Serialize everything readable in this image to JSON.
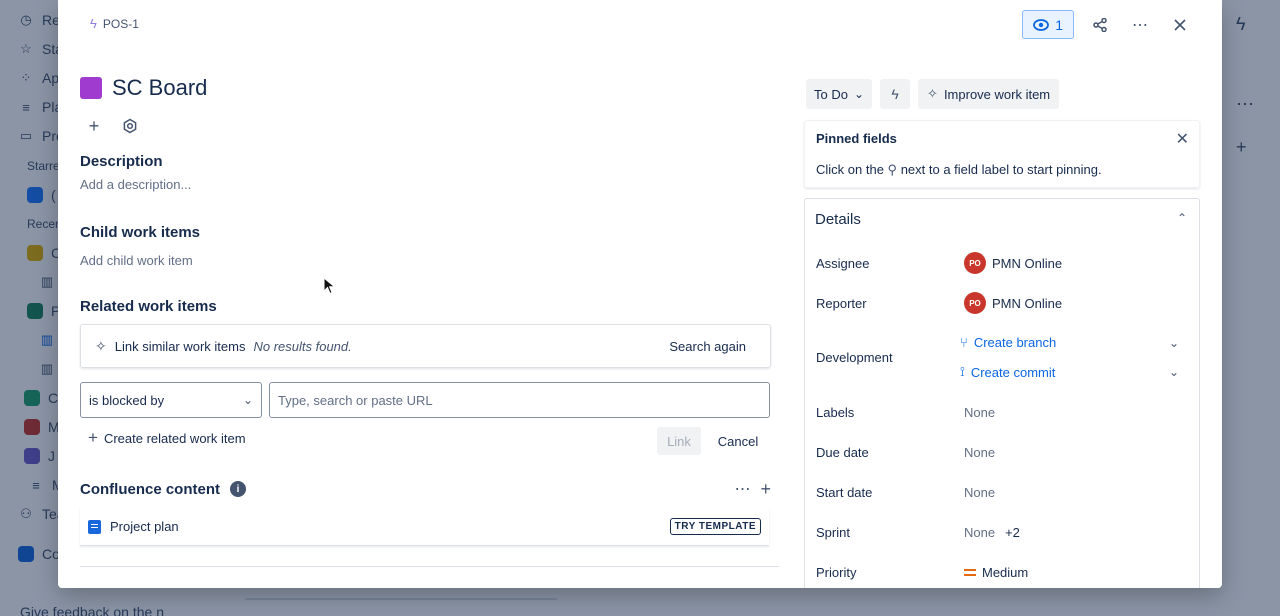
{
  "background": {
    "sidebar": [
      {
        "label": "Rec",
        "icon": "clock-icon"
      },
      {
        "label": "Sta",
        "icon": "star-icon"
      },
      {
        "label": "App",
        "icon": "apps-icon"
      },
      {
        "label": "Pla",
        "icon": "plans-icon"
      },
      {
        "label": "Pro",
        "icon": "projects-icon"
      },
      {
        "label": "Starre",
        "icon": ""
      },
      {
        "label": "(",
        "icon": "cloud-project-icon"
      },
      {
        "label": "Recen",
        "icon": ""
      },
      {
        "label": "C",
        "icon": "pencil-project-icon"
      },
      {
        "label": "",
        "icon": "board-icon"
      },
      {
        "label": "P",
        "icon": "rocket-project-icon"
      },
      {
        "label": "",
        "icon": "board-icon"
      },
      {
        "label": "",
        "icon": "board-icon"
      },
      {
        "label": "C",
        "icon": "green-project-icon"
      },
      {
        "label": "M",
        "icon": "red-project-icon"
      },
      {
        "label": "J",
        "icon": "bus-project-icon"
      },
      {
        "label": "M",
        "icon": "more-icon"
      },
      {
        "label": "Tea",
        "icon": "teams-icon"
      },
      {
        "label": "Co",
        "icon": "confluence-icon"
      }
    ],
    "feedback": "Give feedback on the n"
  },
  "modal": {
    "issue_key": "POS-1",
    "watch_count": "1",
    "title": "SC Board",
    "description": {
      "heading": "Description",
      "placeholder": "Add a description..."
    },
    "child": {
      "heading": "Child work items",
      "add": "Add child work item"
    },
    "related": {
      "heading": "Related work items",
      "similar_label": "Link similar work items",
      "no_results": "No results found.",
      "search_again": "Search again",
      "relation_type": "is blocked by",
      "url_placeholder": "Type, search or paste URL",
      "create": "Create related work item",
      "link": "Link",
      "cancel": "Cancel"
    },
    "confluence": {
      "heading": "Confluence content",
      "page_title": "Project plan",
      "badge": "TRY TEMPLATE"
    }
  },
  "side": {
    "status": "To Do",
    "improve": "Improve work item",
    "pinned": {
      "title": "Pinned fields",
      "hint_before": "Click on the",
      "hint_after": "next to a field label to start pinning."
    },
    "details": {
      "title": "Details",
      "assignee_label": "Assignee",
      "assignee_initials": "PO",
      "assignee_name": "PMN Online",
      "reporter_label": "Reporter",
      "reporter_initials": "PO",
      "reporter_name": "PMN Online",
      "development_label": "Development",
      "create_branch": "Create branch",
      "create_commit": "Create commit",
      "labels_label": "Labels",
      "labels_value": "None",
      "due_label": "Due date",
      "due_value": "None",
      "start_label": "Start date",
      "start_value": "None",
      "sprint_label": "Sprint",
      "sprint_value": "None",
      "sprint_extra": "+2",
      "priority_label": "Priority",
      "priority_value": "Medium"
    }
  },
  "colors": {
    "title_swatch": "#9f3ccf",
    "link_blue": "#0c66e4",
    "avatar_red": "#c9372c",
    "priority_orange": "#e56910"
  }
}
